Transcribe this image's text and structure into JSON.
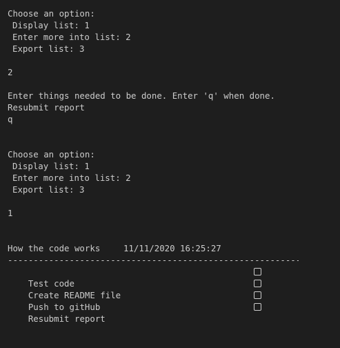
{
  "terminal": {
    "menu1": {
      "prompt": "Choose an option:",
      "options": [
        "Display list: 1",
        "Enter more into list: 2",
        "Export list: 3"
      ],
      "input": "2"
    },
    "entry": {
      "instructions": "Enter things needed to be done. Enter 'q' when done.",
      "items": [
        "Resubmit report",
        "q"
      ]
    },
    "menu2": {
      "prompt": "Choose an option:",
      "options": [
        "Display list: 1",
        "Enter more into list: 2",
        "Export list: 3"
      ],
      "input": "1"
    },
    "report": {
      "title": "How the code works",
      "datetime": "11/11/2020 16:25:27",
      "separator": "------------------------------------------------------------",
      "tasks": [
        {
          "label": "Test code",
          "checkbox_icon": "empty-checkbox-icon"
        },
        {
          "label": "Create README file",
          "checkbox_icon": "empty-checkbox-icon"
        },
        {
          "label": "Push to gitHub",
          "checkbox_icon": "empty-checkbox-icon"
        },
        {
          "label": "Resubmit report",
          "checkbox_icon": "empty-checkbox-icon"
        }
      ]
    }
  }
}
